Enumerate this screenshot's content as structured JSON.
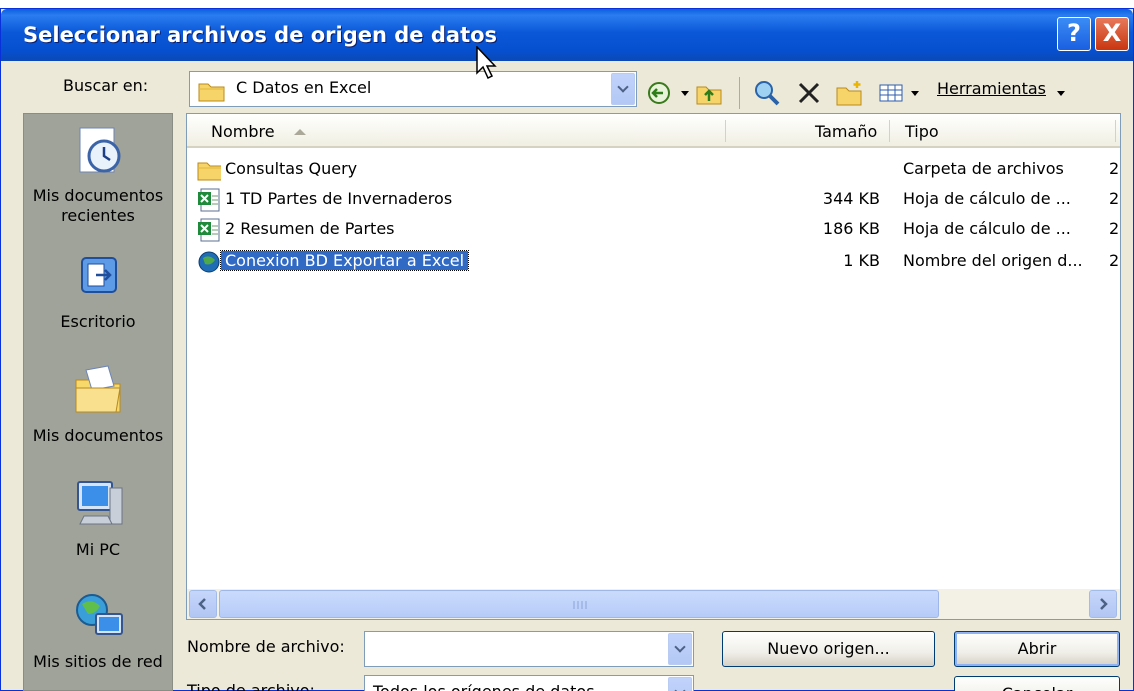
{
  "dialog": {
    "title": "Seleccionar archivos de origen de datos",
    "help_label": "?",
    "close_label": "X"
  },
  "toolbar": {
    "lookin_label": "Buscar en:",
    "lookin_value": "C Datos en Excel",
    "tools_label": "Herramientas",
    "icons": [
      "back-icon",
      "up-folder-icon",
      "search-web-icon",
      "delete-icon",
      "new-folder-icon",
      "views-icon"
    ]
  },
  "places": [
    {
      "label": "Mis documentos recientes",
      "icon": "recent-documents-icon"
    },
    {
      "label": "Escritorio",
      "icon": "desktop-icon"
    },
    {
      "label": "Mis documentos",
      "icon": "my-documents-icon"
    },
    {
      "label": "Mi PC",
      "icon": "my-computer-icon"
    },
    {
      "label": "Mis sitios de red",
      "icon": "network-places-icon"
    }
  ],
  "columns": {
    "name": "Nombre",
    "size": "Tamaño",
    "type": "Tipo"
  },
  "files": [
    {
      "name": "Consultas Query",
      "size": "",
      "type": "Carpeta de archivos",
      "extra": "2",
      "icon": "folder-icon"
    },
    {
      "name": "1 TD Partes de Invernaderos",
      "size": "344 KB",
      "type": "Hoja de cálculo de ...",
      "extra": "2",
      "icon": "excel-file-icon"
    },
    {
      "name": "2 Resumen de Partes",
      "size": "186 KB",
      "type": "Hoja de cálculo de ...",
      "extra": "2",
      "icon": "excel-file-icon"
    },
    {
      "name": "Conexion BD Exportar a Excel",
      "size": "1 KB",
      "type": "Nombre del origen d...",
      "extra": "2",
      "icon": "data-source-icon",
      "selected": true
    }
  ],
  "footer": {
    "filename_label": "Nombre de archivo:",
    "filename_value": "",
    "filetype_label": "Tipo de archivo:",
    "filetype_value": "Todos los orígenes de datos",
    "new_source_label": "Nuevo origen...",
    "open_label": "Abrir",
    "cancel_label": "Cancelar"
  }
}
